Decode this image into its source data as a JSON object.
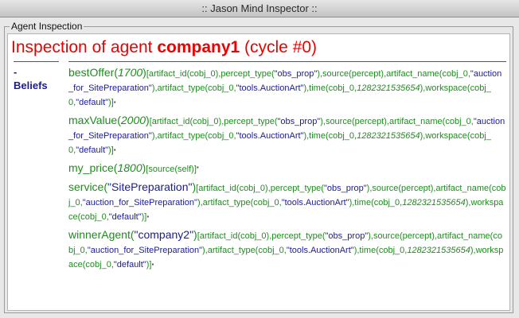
{
  "window": {
    "title": ":: Jason Mind Inspector ::"
  },
  "group": {
    "label": "Agent Inspection"
  },
  "heading": {
    "prefix": "Inspection of agent ",
    "agent": "company1",
    "cycle": " (cycle #0)"
  },
  "section": {
    "dash": "-",
    "title": "Beliefs"
  },
  "beliefs": [
    {
      "name": "bestOffer",
      "args": "1700",
      "annot_a": "[artifact_id(cobj_0),percept_type(",
      "s1": "\"obs_prop\"",
      "annot_b": "),source(percept),artifact_name(cobj_0,",
      "s2": "\"auction_for_SitePreparation\"",
      "annot_c": "),artifact_type(cobj_0,",
      "s3": "\"tools.AuctionArt\"",
      "annot_d": "),time(cobj_0,",
      "time": "1282321535654",
      "annot_e": "),workspace(cobj_0,",
      "s4": "\"default\"",
      "annot_f": ")]"
    },
    {
      "name": "maxValue",
      "args": "2000",
      "annot_a": "[artifact_id(cobj_0),percept_type(",
      "s1": "\"obs_prop\"",
      "annot_b": "),source(percept),artifact_name(cobj_0,",
      "s2": "\"auction_for_SitePreparation\"",
      "annot_c": "),artifact_type(cobj_0,",
      "s3": "\"tools.AuctionArt\"",
      "annot_d": "),time(cobj_0,",
      "time": "1282321535654",
      "annot_e": "),workspace(cobj_0,",
      "s4": "\"default\"",
      "annot_f": ")]"
    },
    {
      "name": "my_price",
      "args": "1800",
      "annot": "[source(self)]"
    },
    {
      "name": "service",
      "args": "\"SitePreparation\"",
      "annot_a": "[artifact_id(cobj_0),percept_type(",
      "s1": "\"obs_prop\"",
      "annot_b": "),source(percept),artifact_name(cobj_0,",
      "s2": "\"auction_for_SitePreparation\"",
      "annot_c": "),artifact_type(cobj_0,",
      "s3": "\"tools.AuctionArt\"",
      "annot_d": "),time(cobj_0,",
      "time": "1282321535654",
      "annot_e": "),workspace(cobj_0,",
      "s4": "\"default\"",
      "annot_f": ")]"
    },
    {
      "name": "winnerAgent",
      "args": "\"company2\"",
      "annot_a": "[artifact_id(cobj_0),percept_type(",
      "s1": "\"obs_prop\"",
      "annot_b": "),source(percept),artifact_name(cobj_0,",
      "s2": "\"auction_for_SitePreparation\"",
      "annot_c": "),artifact_type(cobj_0,",
      "s3": "\"tools.AuctionArt\"",
      "annot_d": "),time(cobj_0,",
      "time": "1282321535654",
      "annot_e": "),workspace(cobj_0,",
      "s4": "\"default\"",
      "annot_f": ")]"
    }
  ],
  "colors": {
    "heading": "#ee0000",
    "belief": "#1f8c1f",
    "string": "#1a1a9a",
    "section": "#1a1a9a"
  }
}
